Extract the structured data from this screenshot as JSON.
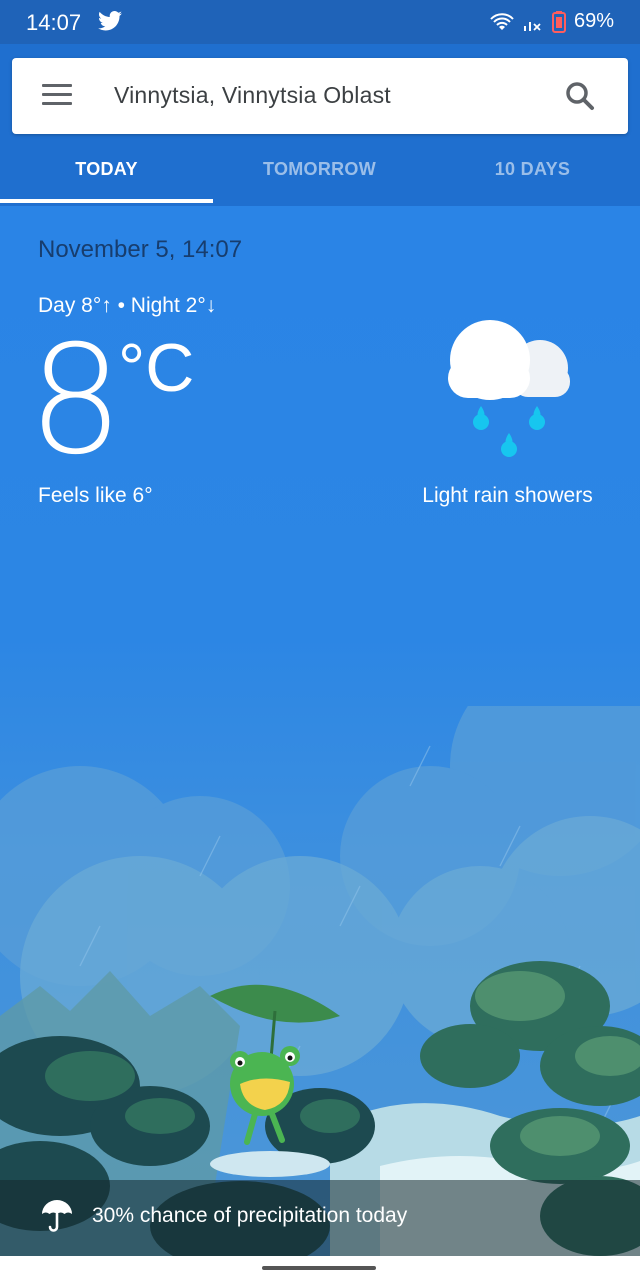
{
  "status": {
    "time": "14:07",
    "battery": "69%",
    "icons": [
      "twitter-icon",
      "wifi-icon",
      "signal-icon",
      "battery-icon"
    ]
  },
  "search": {
    "location": "Vinnytsia, Vinnytsia Oblast"
  },
  "tabs": [
    {
      "label": "TODAY",
      "active": true
    },
    {
      "label": "TOMORROW",
      "active": false
    },
    {
      "label": "10 DAYS",
      "active": false
    }
  ],
  "today": {
    "date": "November 5, 14:07",
    "day_night": "Day 8°↑ • Night 2°↓",
    "temperature": "8",
    "unit": "°C",
    "feels_like": "Feels like 6°",
    "condition": "Light rain showers",
    "condition_icon": "cloud-rain-icon"
  },
  "precipitation": {
    "text": "30% chance of precipitation today",
    "icon": "umbrella-icon"
  },
  "colors": {
    "accent": "#1f6fcf",
    "sky": "#2a84e6",
    "rain": "#17c6ef"
  }
}
